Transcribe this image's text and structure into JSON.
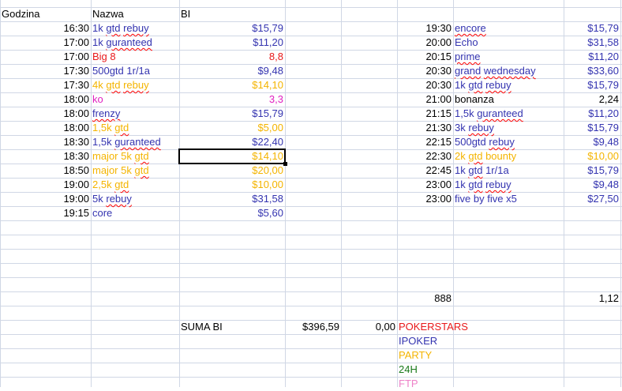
{
  "colors": {
    "pokerstars": "#e8191b",
    "ipoker": "#3434b0",
    "party": "#f4b400",
    "h24": "#1a7a1a",
    "ftp": "#ee82c8",
    "black": "#000000",
    "ko": "#e020c0"
  },
  "headers": {
    "godzina": "Godzina",
    "nazwa": "Nazwa",
    "bi": "BI"
  },
  "left_rows": [
    {
      "time": "16:30",
      "name": "1k gtd rebuy",
      "bi": "$15,79",
      "color": "ipoker",
      "sq": [
        "gtd",
        "rebuy"
      ]
    },
    {
      "time": "17:00",
      "name": "1k guranteed",
      "bi": "$11,20",
      "color": "ipoker",
      "sq": [
        "guranteed"
      ]
    },
    {
      "time": "17:00",
      "name": "Big 8",
      "bi": "8,8",
      "color": "pokerstars",
      "sq": []
    },
    {
      "time": "17:30",
      "name": "500gtd 1r/1a",
      "bi": "$9,48",
      "color": "ipoker",
      "sq": []
    },
    {
      "time": "17:30",
      "name": "4k gtd rebuy",
      "bi": "$14,10",
      "color": "party",
      "sq": [
        "gtd",
        "rebuy"
      ]
    },
    {
      "time": "18:00",
      "name": "ko",
      "bi": "3,3",
      "color": "ko",
      "sq": []
    },
    {
      "time": "18:00",
      "name": "frenzy",
      "bi": "$15,79",
      "color": "ipoker",
      "sq": [
        "frenzy"
      ]
    },
    {
      "time": "18:00",
      "name": "1,5k gtd",
      "bi": "$5,00",
      "color": "party",
      "sq": [
        "gtd"
      ]
    },
    {
      "time": "18:30",
      "name": "1,5k guranteed",
      "bi": "$22,40",
      "color": "ipoker",
      "sq": [
        "guranteed"
      ]
    },
    {
      "time": "18:30",
      "name": "major 5k gtd",
      "bi": "$14,10",
      "color": "party",
      "sq": [
        "gtd"
      ]
    },
    {
      "time": "18:50",
      "name": "major 5k gtd",
      "bi": "$20,00",
      "color": "party",
      "sq": [
        "gtd"
      ]
    },
    {
      "time": "19:00",
      "name": "2,5k gtd",
      "bi": "$10,00",
      "color": "party",
      "sq": [
        "gtd"
      ]
    },
    {
      "time": "19:00",
      "name": "5k rebuy",
      "bi": "$31,58",
      "color": "ipoker",
      "sq": [
        "rebuy"
      ]
    },
    {
      "time": "19:15",
      "name": "core",
      "bi": "$5,60",
      "color": "ipoker",
      "sq": []
    }
  ],
  "right_rows": [
    {
      "time": "19:30",
      "name": "encore",
      "bi": "$15,79",
      "color": "ipoker",
      "sq": [
        "encore"
      ]
    },
    {
      "time": "20:00",
      "name": "Echo",
      "bi": "$31,58",
      "color": "ipoker",
      "sq": []
    },
    {
      "time": "20:15",
      "name": "prime",
      "bi": "$11,20",
      "color": "ipoker",
      "sq": [
        "prime"
      ]
    },
    {
      "time": "20:30",
      "name": "grand wednesday",
      "bi": "$33,60",
      "color": "ipoker",
      "sq": [
        "grand",
        "wednesday"
      ]
    },
    {
      "time": "20:30",
      "name": "1k gtd rebuy",
      "bi": "$15,79",
      "color": "ipoker",
      "sq": [
        "gtd",
        "rebuy"
      ]
    },
    {
      "time": "21:00",
      "name": "bonanza",
      "bi": "2,24",
      "color": "black",
      "sq": []
    },
    {
      "time": "21:15",
      "name": "1,5k guranteed",
      "bi": "$11,20",
      "color": "ipoker",
      "sq": [
        "guranteed"
      ]
    },
    {
      "time": "21:30",
      "name": "3k rebuy",
      "bi": "$15,79",
      "color": "ipoker",
      "sq": [
        "rebuy"
      ]
    },
    {
      "time": "22:15",
      "name": "500gtd rebuy",
      "bi": "$9,48",
      "color": "ipoker",
      "sq": [
        "rebuy"
      ]
    },
    {
      "time": "22:30",
      "name": "2k gtd bounty",
      "bi": "$10,00",
      "color": "party",
      "sq": [
        "gtd"
      ]
    },
    {
      "time": "22:45",
      "name": "1k gtd 1r/1a",
      "bi": "$15,79",
      "color": "ipoker",
      "sq": [
        "gtd"
      ]
    },
    {
      "time": "23:00",
      "name": "1k gtd rebuy",
      "bi": "$9,48",
      "color": "ipoker",
      "sq": [
        "gtd",
        "rebuy"
      ]
    },
    {
      "time": "23:00",
      "name": "five by five x5",
      "bi": "$27,50",
      "color": "ipoker",
      "sq": []
    }
  ],
  "summary": {
    "value_888": "888",
    "value_888_bi": "1,12",
    "suma_label": "SUMA BI",
    "suma_value": "$396,59",
    "zero_value": "0,00"
  },
  "legend": [
    {
      "label": "POKERSTARS",
      "color": "pokerstars"
    },
    {
      "label": "IPOKER",
      "color": "ipoker"
    },
    {
      "label": "PARTY",
      "color": "party"
    },
    {
      "label": "24H",
      "color": "h24"
    },
    {
      "label": "FTP",
      "color": "ftp"
    }
  ]
}
